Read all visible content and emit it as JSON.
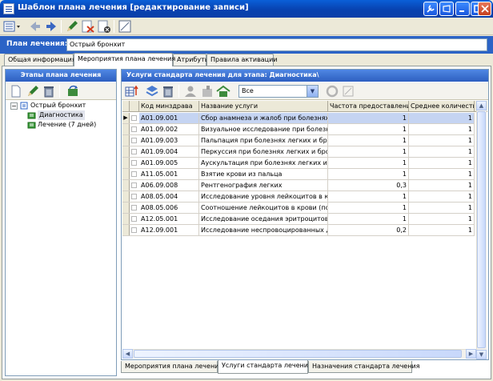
{
  "window": {
    "title": "Шаблон плана лечения [редактирование записи]"
  },
  "plan": {
    "label": "План лечения:",
    "value": "Острый бронхит"
  },
  "tabs": [
    {
      "label": "Общая информация"
    },
    {
      "label": "Мероприятия плана лечения",
      "active": true
    },
    {
      "label": "Атрибуты"
    },
    {
      "label": "Правила активации"
    }
  ],
  "left_panel": {
    "title": "Этапы плана лечения",
    "tree": [
      {
        "label": "Острый бронхит",
        "level": 0
      },
      {
        "label": "Диагностика",
        "level": 1,
        "selected": true
      },
      {
        "label": "Лечение (7 дней)",
        "level": 1
      }
    ]
  },
  "right_panel": {
    "title": "Услуги стандарта лечения для этапа: Диагностика\\",
    "filter": {
      "value": "Все"
    },
    "columns": [
      "Код минздрава",
      "Название услуги",
      "Частота предоставления",
      "Среднее количество"
    ],
    "rows": [
      {
        "code": "A01.09.001",
        "name": "Сбор анамнеза и жалоб при болезнях л",
        "freq": "1",
        "avg": "1",
        "selected": true
      },
      {
        "code": "A01.09.002",
        "name": "Визуальное исследование при болезнях",
        "freq": "1",
        "avg": "1"
      },
      {
        "code": "A01.09.003",
        "name": "Пальпация при болезнях легких и бронх",
        "freq": "1",
        "avg": "1"
      },
      {
        "code": "A01.09.004",
        "name": "Перкуссия при болезнях легких и бронхо",
        "freq": "1",
        "avg": "1"
      },
      {
        "code": "A01.09.005",
        "name": "Аускультация при болезнях легких и брон",
        "freq": "1",
        "avg": "1"
      },
      {
        "code": "A11.05.001",
        "name": "Взятие крови из пальца",
        "freq": "1",
        "avg": "1"
      },
      {
        "code": "A06.09.008",
        "name": "Рентгенография легких",
        "freq": "0,3",
        "avg": "1"
      },
      {
        "code": "A08.05.004",
        "name": "Исследование уровня лейкоцитов в кров",
        "freq": "1",
        "avg": "1"
      },
      {
        "code": "A08.05.006",
        "name": "Соотношение лейкоцитов в крови (подсч",
        "freq": "1",
        "avg": "1"
      },
      {
        "code": "A12.05.001",
        "name": "Исследование оседания эритроцитов",
        "freq": "1",
        "avg": "1"
      },
      {
        "code": "A12.09.001",
        "name": "Исследование неспровоцированных дых",
        "freq": "0,2",
        "avg": "1"
      }
    ]
  },
  "bottom_tabs": [
    {
      "label": "Мероприятия плана лечения"
    },
    {
      "label": "Услуги стандарта лечения",
      "active": true
    },
    {
      "label": "Назначения стандарта лечения"
    }
  ],
  "colors": {
    "title_blue": "#0842b0",
    "plan_bar": "#2b63c6",
    "selection": "#c5d4f2"
  }
}
